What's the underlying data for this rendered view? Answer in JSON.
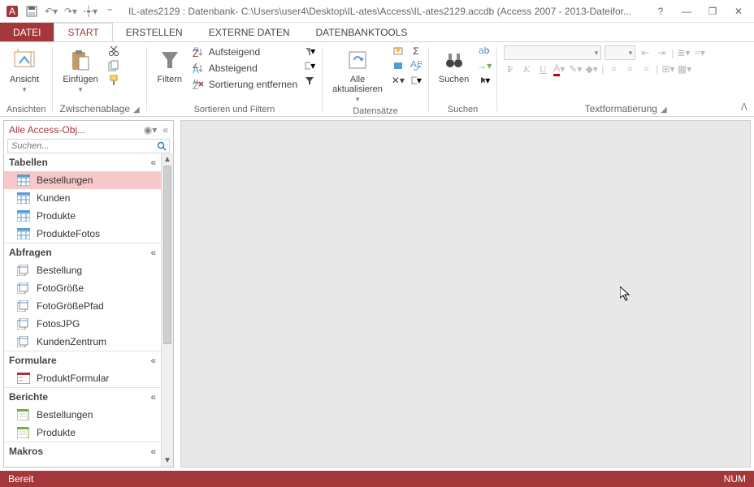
{
  "title": "IL-ates2129 : Datenbank- C:\\Users\\user4\\Desktop\\IL-ates\\Access\\IL-ates2129.accdb (Access 2007 - 2013-Dateifor...",
  "tabs": {
    "datei": "DATEI",
    "start": "START",
    "erstellen": "ERSTELLEN",
    "externe": "EXTERNE DATEN",
    "tools": "DATENBANKTOOLS"
  },
  "ribbon": {
    "ansichten": {
      "label": "Ansichten",
      "ansicht": "Ansicht"
    },
    "clipboard": {
      "label": "Zwischenablage",
      "paste": "Einfügen"
    },
    "sort": {
      "label": "Sortieren und Filtern",
      "filter": "Filtern",
      "asc": "Aufsteigend",
      "desc": "Absteigend",
      "remove": "Sortierung entfernen"
    },
    "records": {
      "label": "Datensätze",
      "refresh": "Alle\naktualisieren"
    },
    "find": {
      "label": "Suchen",
      "find": "Suchen"
    },
    "format": {
      "label": "Textformatierung"
    }
  },
  "nav": {
    "title": "Alle Access-Obj...",
    "search_placeholder": "Suchen...",
    "categories": {
      "tabellen": "Tabellen",
      "abfragen": "Abfragen",
      "formulare": "Formulare",
      "berichte": "Berichte",
      "makros": "Makros"
    },
    "tables": [
      "Bestellungen",
      "Kunden",
      "Produkte",
      "ProdukteFotos"
    ],
    "queries": [
      "Bestellung",
      "FotoGröße",
      "FotoGrößePfad",
      "FotosJPG",
      "KundenZentrum"
    ],
    "forms": [
      "ProduktFormular"
    ],
    "reports": [
      "Bestellungen",
      "Produkte"
    ]
  },
  "status": {
    "ready": "Bereit",
    "num": "NUM"
  }
}
